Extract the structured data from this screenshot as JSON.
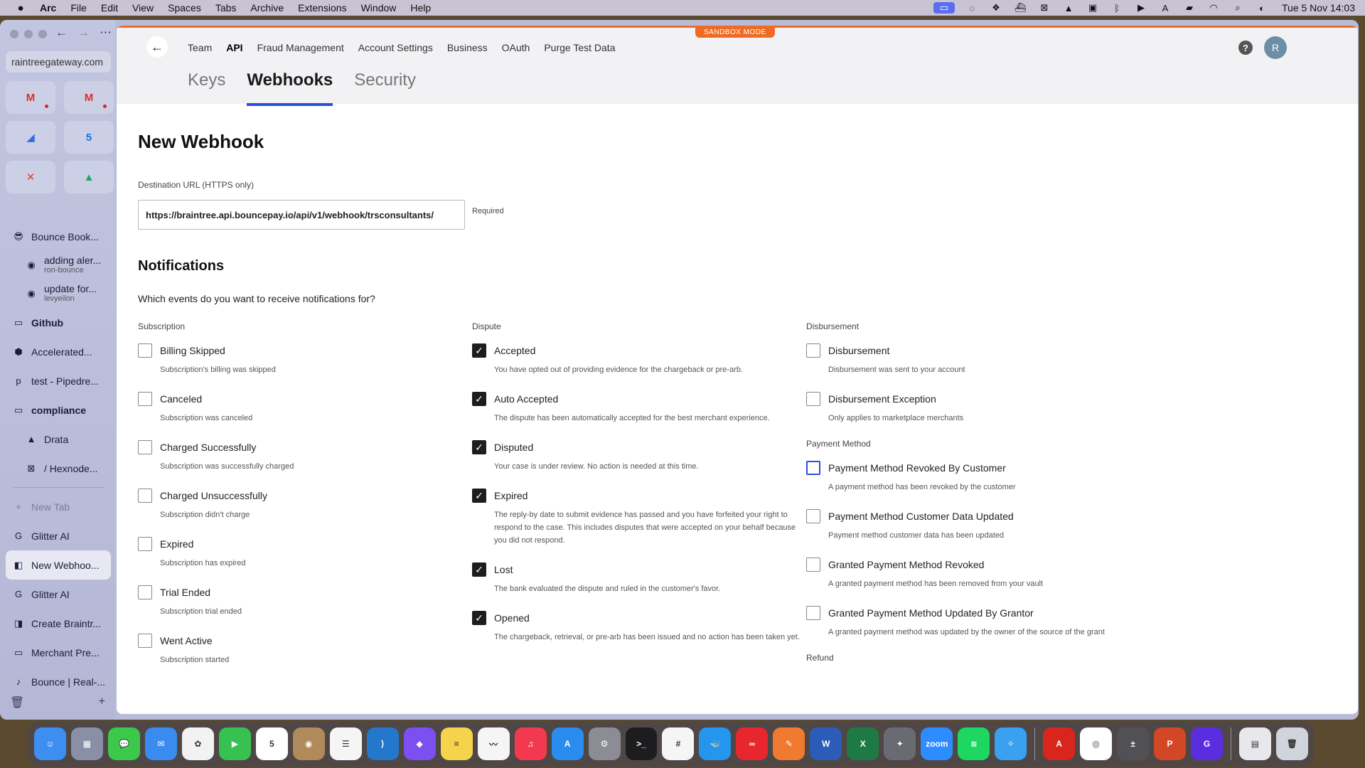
{
  "menubar": {
    "app": "Arc",
    "items": [
      "File",
      "Edit",
      "View",
      "Spaces",
      "Tabs",
      "Archive",
      "Extensions",
      "Window",
      "Help"
    ],
    "clock": "Tue 5 Nov  14:03"
  },
  "sidebar": {
    "url": "raintreegateway.com",
    "favorites": [
      {
        "icon": "gmail-icon",
        "glyph": "M",
        "color": "#d93025",
        "dot": true
      },
      {
        "icon": "gmail-icon",
        "glyph": "M",
        "color": "#d93025",
        "dot": true
      },
      {
        "icon": "linear-icon",
        "glyph": "◢",
        "color": "#2f6fe0",
        "dot": false
      },
      {
        "icon": "calendar-icon",
        "glyph": "5",
        "color": "#1a73e8",
        "dot": false
      },
      {
        "icon": "x-app-icon",
        "glyph": "✕",
        "color": "#e0402a",
        "dot": false
      },
      {
        "icon": "drive-icon",
        "glyph": "▲",
        "color": "#1fa463",
        "dot": false
      }
    ],
    "items": [
      {
        "label": "Bounce Book...",
        "icon": "😎",
        "kind": "normal"
      },
      {
        "label": "adding aler...",
        "sub": "ron-bounce",
        "icon": "◉",
        "kind": "two-line"
      },
      {
        "label": "update for...",
        "sub": "levyeilon",
        "icon": "◉",
        "kind": "two-line"
      },
      {
        "label": "Github",
        "icon": "▭",
        "kind": "folder"
      },
      {
        "label": "Accelerated...",
        "icon": "⬢",
        "kind": "normal"
      },
      {
        "label": "test - Pipedre...",
        "icon": "p",
        "kind": "normal"
      },
      {
        "label": "compliance",
        "icon": "▭",
        "kind": "folder"
      },
      {
        "label": "Drata",
        "icon": "▲",
        "kind": "sub"
      },
      {
        "label": "/ Hexnode...",
        "icon": "⊠",
        "kind": "sub"
      },
      {
        "label": "New Tab",
        "icon": "+",
        "kind": "dim"
      },
      {
        "label": "Glitter AI",
        "icon": "G",
        "kind": "normal"
      },
      {
        "label": "New Webhoo...",
        "icon": "◧",
        "kind": "selected"
      },
      {
        "label": "Glitter AI",
        "icon": "G",
        "kind": "normal"
      },
      {
        "label": "Create Braintr...",
        "icon": "◨",
        "kind": "normal"
      },
      {
        "label": "Merchant Pre...",
        "icon": "▭",
        "kind": "normal"
      },
      {
        "label": "Bounce | Real-...",
        "icon": "♪",
        "kind": "normal"
      }
    ]
  },
  "topbar": {
    "sandbox": "SANDBOX MODE",
    "nav": [
      "Team",
      "API",
      "Fraud Management",
      "Account Settings",
      "Business",
      "OAuth",
      "Purge Test Data"
    ],
    "active_nav": "API",
    "avatar": "R",
    "help": "?"
  },
  "tabs": [
    "Keys",
    "Webhooks",
    "Security"
  ],
  "active_tab": "Webhooks",
  "form": {
    "title": "New Webhook",
    "url_label": "Destination URL (HTTPS only)",
    "url_value": "https://braintree.api.bouncepay.io/api/v1/webhook/trsconsultants/",
    "required": "Required",
    "notifications_title": "Notifications",
    "question": "Which events do you want to receive notifications for?"
  },
  "columns": [
    {
      "groups": [
        {
          "label": "Subscription",
          "options": [
            {
              "label": "Billing Skipped",
              "desc": "Subscription's billing was skipped",
              "checked": false
            },
            {
              "label": "Canceled",
              "desc": "Subscription was canceled",
              "checked": false
            },
            {
              "label": "Charged Successfully",
              "desc": "Subscription was successfully charged",
              "checked": false
            },
            {
              "label": "Charged Unsuccessfully",
              "desc": "Subscription didn't charge",
              "checked": false
            },
            {
              "label": "Expired",
              "desc": "Subscription has expired",
              "checked": false
            },
            {
              "label": "Trial Ended",
              "desc": "Subscription trial ended",
              "checked": false
            },
            {
              "label": "Went Active",
              "desc": "Subscription started",
              "checked": false
            }
          ]
        }
      ]
    },
    {
      "groups": [
        {
          "label": "Dispute",
          "options": [
            {
              "label": "Accepted",
              "desc": "You have opted out of providing evidence for the chargeback or pre-arb.",
              "checked": true
            },
            {
              "label": "Auto Accepted",
              "desc": "The dispute has been automatically accepted for the best merchant experience.",
              "checked": true
            },
            {
              "label": "Disputed",
              "desc": "Your case is under review. No action is needed at this time.",
              "checked": true
            },
            {
              "label": "Expired",
              "desc": "The reply-by date to submit evidence has passed and you have forfeited your right to respond to the case. This includes disputes that were accepted on your behalf because you did not respond.",
              "checked": true
            },
            {
              "label": "Lost",
              "desc": "The bank evaluated the dispute and ruled in the customer's favor.",
              "checked": true
            },
            {
              "label": "Opened",
              "desc": "The chargeback, retrieval, or pre-arb has been issued and no action has been taken yet.",
              "checked": true
            }
          ]
        }
      ]
    },
    {
      "groups": [
        {
          "label": "Disbursement",
          "options": [
            {
              "label": "Disbursement",
              "desc": "Disbursement was sent to your account",
              "checked": false
            },
            {
              "label": "Disbursement Exception",
              "desc": "Only applies to marketplace merchants",
              "checked": false
            }
          ]
        },
        {
          "label": "Payment Method",
          "options": [
            {
              "label": "Payment Method Revoked By Customer",
              "desc": "A payment method has been revoked by the customer",
              "checked": false,
              "focus": true
            },
            {
              "label": "Payment Method Customer Data Updated",
              "desc": "Payment method customer data has been updated",
              "checked": false
            },
            {
              "label": "Granted Payment Method Revoked",
              "desc": "A granted payment method has been removed from your vault",
              "checked": false
            },
            {
              "label": "Granted Payment Method Updated By Grantor",
              "desc": "A granted payment method was updated by the owner of the source of the grant",
              "checked": false
            }
          ]
        },
        {
          "label": "Refund",
          "options": []
        }
      ]
    }
  ],
  "dock": [
    {
      "name": "finder-icon",
      "color": "#3d8ef0",
      "glyph": "☺"
    },
    {
      "name": "launchpad-icon",
      "color": "#8a8fa8",
      "glyph": "▦"
    },
    {
      "name": "messages-icon",
      "color": "#3cc84a",
      "glyph": "💬"
    },
    {
      "name": "mail-icon",
      "color": "#3a8bf0",
      "glyph": "✉"
    },
    {
      "name": "photos-icon",
      "color": "#f2f2f2",
      "glyph": "✿"
    },
    {
      "name": "facetime-icon",
      "color": "#36c150",
      "glyph": "▶"
    },
    {
      "name": "calendar-icon",
      "color": "#ffffff",
      "glyph": "5"
    },
    {
      "name": "contacts-icon",
      "color": "#b08a5a",
      "glyph": "◉"
    },
    {
      "name": "reminders-icon",
      "color": "#f5f5f5",
      "glyph": "☰"
    },
    {
      "name": "vscode-icon",
      "color": "#2478cc",
      "glyph": "⟩"
    },
    {
      "name": "affinity-icon",
      "color": "#7b4ff0",
      "glyph": "◆"
    },
    {
      "name": "notes-icon",
      "color": "#f5d34a",
      "glyph": "≡"
    },
    {
      "name": "freeform-icon",
      "color": "#f5f5f5",
      "glyph": "〰"
    },
    {
      "name": "music-icon",
      "color": "#f2394f",
      "glyph": "♫"
    },
    {
      "name": "appstore-icon",
      "color": "#2b8cf0",
      "glyph": "A"
    },
    {
      "name": "settings-icon",
      "color": "#8c8c94",
      "glyph": "⚙"
    },
    {
      "name": "terminal-icon",
      "color": "#1d1d1f",
      "glyph": ">_"
    },
    {
      "name": "slack-icon",
      "color": "#f5f5f5",
      "glyph": "#"
    },
    {
      "name": "docker-icon",
      "color": "#2496ed",
      "glyph": "🐳"
    },
    {
      "name": "creative-cloud-icon",
      "color": "#e8262d",
      "glyph": "∞"
    },
    {
      "name": "pencil-icon",
      "color": "#f07a30",
      "glyph": "✎"
    },
    {
      "name": "word-icon",
      "color": "#2b5cb8",
      "glyph": "W"
    },
    {
      "name": "excel-icon",
      "color": "#1e7a45",
      "glyph": "X"
    },
    {
      "name": "keynote-icon",
      "color": "#6a6a72",
      "glyph": "✦"
    },
    {
      "name": "zoom-icon",
      "color": "#2d8cff",
      "glyph": "zoom"
    },
    {
      "name": "spotify-icon",
      "color": "#1ed760",
      "glyph": "≋"
    },
    {
      "name": "safari-icon",
      "color": "#3aa0f0",
      "glyph": "✧"
    },
    {
      "name": "acrobat-icon",
      "color": "#d8261c",
      "glyph": "A"
    },
    {
      "name": "chrome-icon",
      "color": "#ffffff",
      "glyph": "◎"
    },
    {
      "name": "calculator-icon",
      "color": "#505055",
      "glyph": "±"
    },
    {
      "name": "powerpoint-icon",
      "color": "#d24726",
      "glyph": "P"
    },
    {
      "name": "glitter-icon",
      "color": "#5a2ee0",
      "glyph": "G"
    },
    {
      "name": "documents-icon",
      "color": "#e8e8ec",
      "glyph": "▤"
    },
    {
      "name": "trash-icon",
      "color": "#d0d4dc",
      "glyph": "🗑"
    }
  ]
}
